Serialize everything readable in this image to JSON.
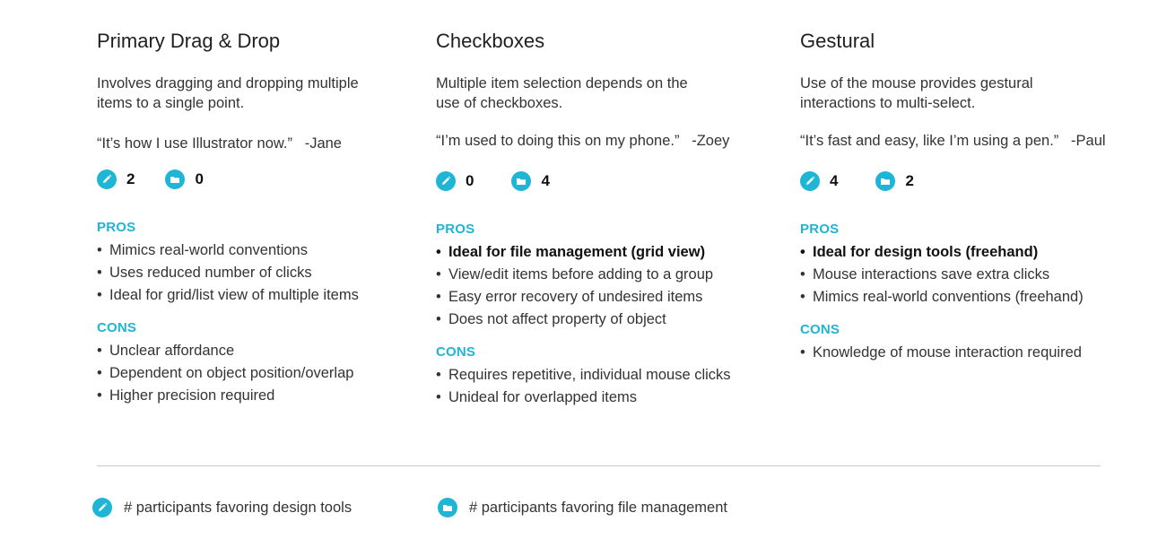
{
  "colors": {
    "accent": "#1fb5d4",
    "divider": "#c8c8c8"
  },
  "icons": {
    "design_tools": "pencil-icon",
    "file_management": "folder-icon"
  },
  "columns": [
    {
      "title": "Primary Drag & Drop",
      "description": "Involves dragging and dropping multiple\nitems to a single point.",
      "quote": "“It’s how I use Illustrator now.”   -Jane",
      "design_tools_count": "2",
      "file_management_count": "0",
      "pros_label": "PROS",
      "pros": [
        "Mimics real-world conventions",
        "Uses reduced number of clicks",
        "Ideal for grid/list view of multiple items"
      ],
      "cons_label": "CONS",
      "cons": [
        "Unclear affordance",
        "Dependent on object position/overlap",
        "Higher precision required"
      ]
    },
    {
      "title": "Checkboxes",
      "description": "Multiple item selection depends on the\nuse of checkboxes.",
      "quote": "“I’m used to doing this on my phone.”   -Zoey",
      "design_tools_count": "0",
      "file_management_count": "4",
      "pros_label": "PROS",
      "pros": [
        "Ideal for file management (grid view)",
        "View/edit items before adding to a group",
        "Easy error recovery of undesired items",
        "Does not affect property of object"
      ],
      "cons_label": "CONS",
      "cons": [
        "Requires repetitive, individual mouse clicks",
        "Unideal for overlapped items"
      ]
    },
    {
      "title": "Gestural",
      "description": "Use of the mouse provides gestural\ninteractions to multi-select.",
      "quote": "“It’s fast and easy, like I’m using a pen.”   -Paul",
      "design_tools_count": "4",
      "file_management_count": "2",
      "pros_label": "PROS",
      "pros": [
        "Ideal for design tools (freehand)",
        "Mouse interactions save extra clicks",
        "Mimics real-world conventions (freehand)"
      ],
      "cons_label": "CONS",
      "cons": [
        "Knowledge of mouse interaction required"
      ]
    }
  ],
  "legend": {
    "design_tools": "# participants favoring design tools",
    "file_management": "# participants favoring file management"
  }
}
